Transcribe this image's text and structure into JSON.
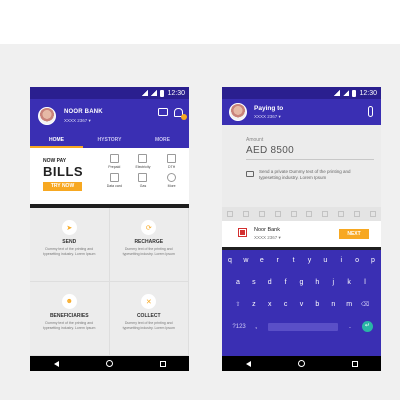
{
  "colors": {
    "primary": "#3a2fb3",
    "accent": "#f7a821",
    "enter": "#29b6a5"
  },
  "status": {
    "time": "12:30"
  },
  "home": {
    "bank_name": "NOOR BANK",
    "account": "XXXX 2367",
    "tabs": [
      {
        "label": "HOME",
        "active": true
      },
      {
        "label": "HYSTORY",
        "active": false
      },
      {
        "label": "MORE",
        "active": false
      }
    ],
    "promo": {
      "line1": "NOW PAY",
      "line2": "BILLS",
      "button": "TRY NOW"
    },
    "bill_types": [
      {
        "label": "Prepaid",
        "icon": "shirt-icon"
      },
      {
        "label": "Electricity",
        "icon": "lightning-icon"
      },
      {
        "label": "DTH",
        "icon": "tv-icon"
      },
      {
        "label": "Data card",
        "icon": "sim-card-icon"
      },
      {
        "label": "Gas",
        "icon": "gas-icon"
      },
      {
        "label": "More",
        "icon": "plus-icon"
      }
    ],
    "services": [
      {
        "title": "SEND",
        "desc": "Dummy text of the printing and typesetting industry. Lorem Ipsum",
        "icon": "send-icon"
      },
      {
        "title": "RECHARGE",
        "desc": "Dummy text of the printing and typesetting industry. Lorem Ipsum",
        "icon": "recharge-icon"
      },
      {
        "title": "BENEFICIARIES",
        "desc": "Dummy text of the printing and typesetting industry. Lorem Ipsum",
        "icon": "beneficiaries-icon"
      },
      {
        "title": "COLLECT",
        "desc": "Dummy text of the printing and typesetting industry. Lorem Ipsum",
        "icon": "collect-icon"
      }
    ]
  },
  "pay": {
    "title": "Paying to",
    "account": "XXXX 2367",
    "amount_label": "Amount",
    "amount": "AED 8500",
    "note": "Send a private Dummy text of the printing and typesetting industry. Lorem Ipsum",
    "payee_name": "Noor Bank",
    "payee_account": "XXXX 2367",
    "next_label": "NEXT",
    "keyboard": {
      "row1": [
        "q",
        "w",
        "e",
        "r",
        "t",
        "y",
        "u",
        "i",
        "o",
        "p"
      ],
      "row2": [
        "a",
        "s",
        "d",
        "f",
        "g",
        "h",
        "j",
        "k",
        "l"
      ],
      "row3": [
        "z",
        "x",
        "c",
        "v",
        "b",
        "n",
        "m"
      ],
      "shift": "⇧",
      "backspace": "⌫",
      "symbols": "?123",
      "comma": ",",
      "period": ".",
      "enter": "↵"
    }
  }
}
